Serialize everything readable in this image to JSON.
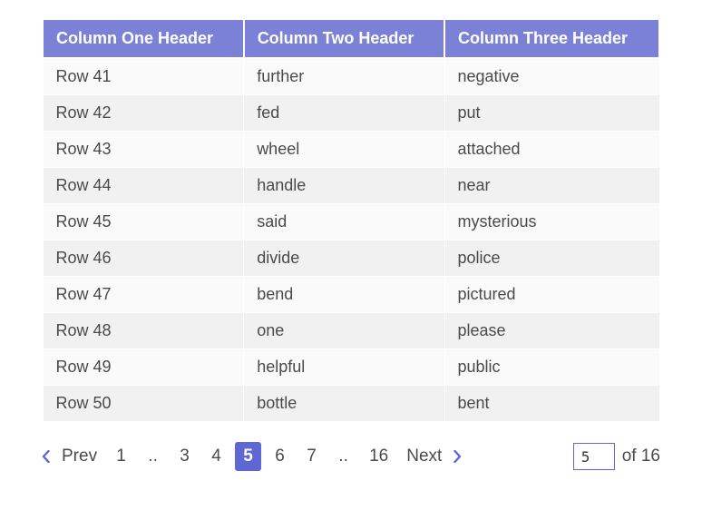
{
  "table": {
    "headers": [
      "Column One Header",
      "Column Two Header",
      "Column Three Header"
    ],
    "rows": [
      {
        "c1": "Row 41",
        "c2": "further",
        "c3": "negative"
      },
      {
        "c1": "Row 42",
        "c2": "fed",
        "c3": "put"
      },
      {
        "c1": "Row 43",
        "c2": "wheel",
        "c3": "attached"
      },
      {
        "c1": "Row 44",
        "c2": "handle",
        "c3": "near"
      },
      {
        "c1": "Row 45",
        "c2": "said",
        "c3": "mysterious"
      },
      {
        "c1": "Row 46",
        "c2": "divide",
        "c3": "police"
      },
      {
        "c1": "Row 47",
        "c2": "bend",
        "c3": "pictured"
      },
      {
        "c1": "Row 48",
        "c2": "one",
        "c3": "please"
      },
      {
        "c1": "Row 49",
        "c2": "helpful",
        "c3": "public"
      },
      {
        "c1": "Row 50",
        "c2": "bottle",
        "c3": "bent"
      }
    ]
  },
  "pager": {
    "prev_label": "Prev",
    "next_label": "Next",
    "ellipsis": "..",
    "pages_visible": [
      "1",
      "..",
      "3",
      "4",
      "5",
      "6",
      "7",
      "..",
      "16"
    ],
    "current_page": "5",
    "jump_value": "5",
    "jump_of_label": "of 16"
  },
  "colors": {
    "accent": "#7a81d6",
    "accent_strong": "#5f67d4"
  }
}
